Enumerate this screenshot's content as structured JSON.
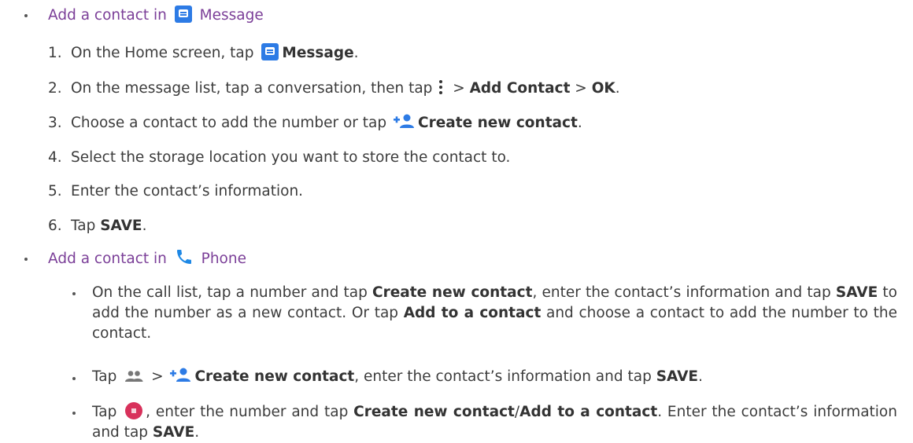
{
  "sections": [
    {
      "heading_prefix": "Add a contact in",
      "heading_icon": "message-icon",
      "heading_app": "Message",
      "steps": [
        {
          "number": "1.",
          "text_a": "On the Home screen, tap",
          "icon": "message-icon",
          "bold_a": "Message",
          "text_b": "."
        },
        {
          "number": "2.",
          "text_a": "On the message list, tap a conversation, then tap",
          "icon": "more-vert-icon",
          "text_b": " > ",
          "bold_a": "Add Contact",
          "text_c": " > ",
          "bold_b": "OK",
          "text_d": "."
        },
        {
          "number": "3.",
          "text_a": "Choose a contact to add the number or tap",
          "icon": "add-person-icon",
          "bold_a": "Create new contact",
          "text_b": "."
        },
        {
          "number": "4.",
          "text_a": "Select the storage location you want to store the contact to."
        },
        {
          "number": "5.",
          "text_a": "Enter the contact’s information."
        },
        {
          "number": "6.",
          "text_a": "Tap",
          "bold_a": "SAVE",
          "text_b": "."
        }
      ]
    },
    {
      "heading_prefix": "Add a contact in",
      "heading_icon": "phone-icon",
      "heading_app": "Phone",
      "items": [
        {
          "p1": "On the call list, tap a number and tap",
          "b1": "Create new contact",
          "p2": ", enter the contact’s information and tap",
          "b2": "SAVE",
          "p3": " to add the number as a new contact. Or tap",
          "b3": "Add to a contact",
          "p4": " and choose a contact to add the number to the contact."
        },
        {
          "p1": "Tap",
          "icon1": "people-icon",
          "p2": " > ",
          "icon2": "add-person-icon",
          "b1": "Create new contact",
          "p3": ", enter the contact’s information and tap",
          "b2": "SAVE",
          "p4": "."
        },
        {
          "p1": "Tap",
          "icon1": "dialpad-icon",
          "p2": ", enter the number and tap",
          "b1": "Create new contact",
          "p3": "/",
          "b2": "Add to a contact",
          "p4": ". Enter the contact’s information and tap",
          "b3": "SAVE",
          "p5": "."
        }
      ]
    }
  ],
  "colors": {
    "heading": "#7b3f98",
    "text": "#3c3c3c",
    "message_icon": "#2d7be5",
    "phone_icon": "#1e88e5",
    "dialpad_icon": "#d8315b"
  }
}
